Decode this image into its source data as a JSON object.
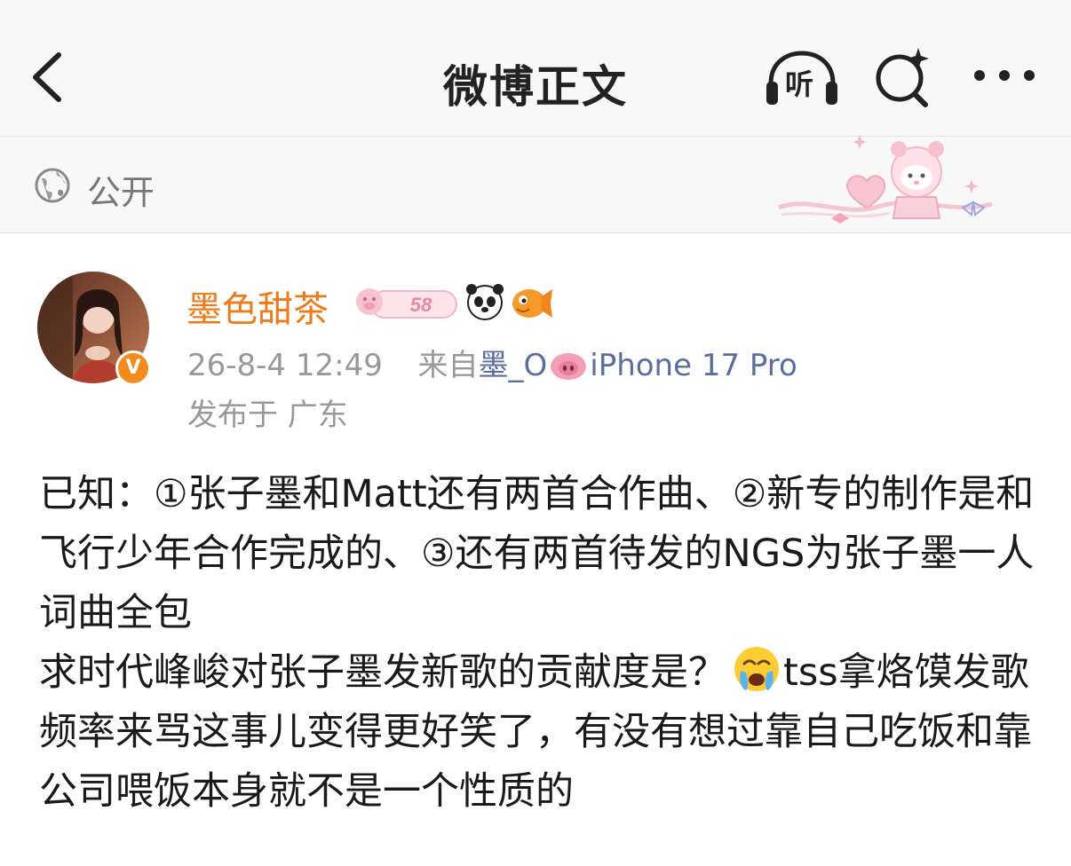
{
  "header": {
    "title": "微博正文",
    "listen_label": "听"
  },
  "visibility": {
    "label": "公开"
  },
  "author": {
    "name": "墨色甜茶",
    "badge_number": "58",
    "verified_mark": "V",
    "timestamp": "26-8-4 12:49",
    "source_prefix": "来自",
    "source_name": "墨_O",
    "source_device": "iPhone 17 Pro",
    "location": "发布于 广东"
  },
  "post": {
    "paragraph1": "已知：①张子墨和Matt还有两首合作曲、②新专的制作是和飞行少年合作完成的、③还有两首待发的NGS为张子墨一人词曲全包",
    "paragraph2_before_emoji": "求时代峰峻对张子墨发新歌的贡献度是？",
    "paragraph2_after_emoji": "tss拿烙馍发歌频率来骂这事儿变得更好笑了，有没有想过靠自己吃饭和靠公司喂饭本身就不是一个性质的"
  },
  "colors": {
    "username": "#ef7a1a",
    "source_link": "#5b6f9e",
    "verified_badge": "#f28c1e",
    "meta_text": "#999999"
  },
  "icons": [
    "back-icon",
    "headphones-icon",
    "search-sparkle-icon",
    "more-icon",
    "globe-icon",
    "panda-icon",
    "fish-icon",
    "pig-icon",
    "crying-emoji-icon"
  ]
}
